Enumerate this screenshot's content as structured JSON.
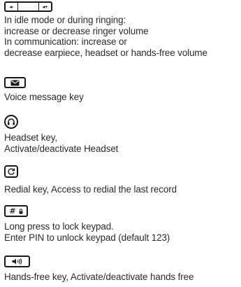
{
  "keys": [
    {
      "icon": "volume-rocker-icon",
      "icon_text": {
        "minus": "◂-",
        "plus": "◂+"
      },
      "lines": [
        "In idle mode or during ringing:",
        "increase or decrease ringer volume",
        "In communication: increase or",
        "decrease earpiece, headset or hands-free volume"
      ]
    },
    {
      "icon": "envelope-icon",
      "lines": [
        "Voice message key"
      ]
    },
    {
      "icon": "headset-icon",
      "lines": [
        "Headset key,",
        "Activate/deactivate Headset"
      ]
    },
    {
      "icon": "redial-icon",
      "lines": [
        "Redial key, Access to redial the last record"
      ]
    },
    {
      "icon": "hash-lock-icon",
      "icon_text": {
        "hash": "#"
      },
      "lines": [
        "Long press to lock keypad.",
        "Enter PIN to unlock keypad (default 123)"
      ]
    },
    {
      "icon": "speaker-icon",
      "lines": [
        "Hands-free key, Activate/deactivate hands free"
      ]
    }
  ]
}
